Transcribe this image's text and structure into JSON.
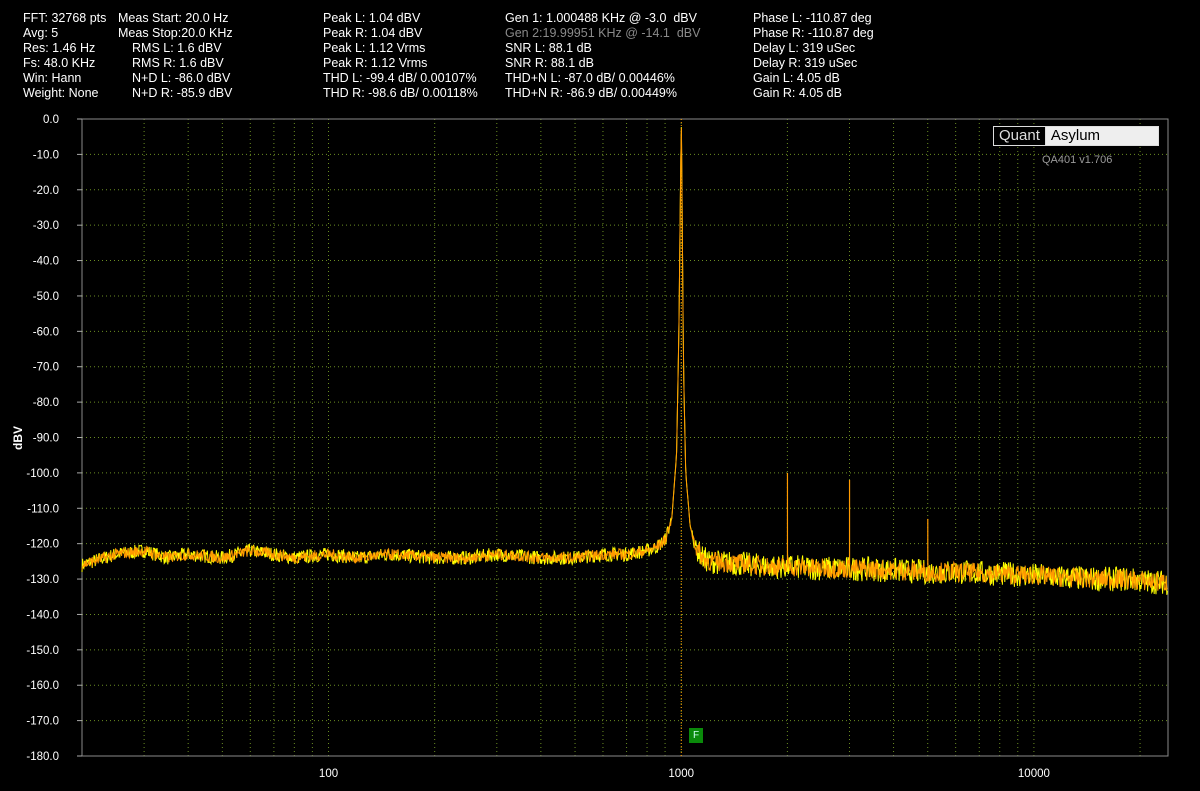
{
  "stats": {
    "col1": [
      "FFT: 32768 pts",
      "Avg: 5",
      "Res: 1.46 Hz",
      "Fs: 48.0 KHz",
      "Win: Hann",
      "Weight: None"
    ],
    "col2": [
      "Meas Start: 20.0 Hz",
      "Meas Stop:20.0 KHz",
      "RMS L: 1.6 dBV",
      "RMS R: 1.6 dBV",
      "N+D L: -86.0 dBV",
      "N+D R: -85.9 dBV"
    ],
    "col3": [
      "Peak L: 1.04 dBV",
      "Peak R: 1.04 dBV",
      "Peak L: 1.12 Vrms",
      "Peak R: 1.12 Vrms",
      "THD L: -99.4 dB/ 0.00107%",
      "THD R: -98.6 dB/ 0.00118%"
    ],
    "col4": [
      "Gen 1: 1.000488 KHz @ -3.0  dBV",
      "Gen 2:19.99951 KHz @ -14.1  dBV",
      "SNR L: 88.1 dB",
      "SNR R: 88.1 dB",
      "THD+N L: -87.0 dB/ 0.00446%",
      "THD+N R: -86.9 dB/ 0.00449%"
    ],
    "col5": [
      "Phase L: -110.87 deg",
      "Phase R: -110.87 deg",
      "Delay L: 319 uSec",
      "Delay R: 319 uSec",
      "Gain L: 4.05 dB",
      "Gain R: 4.05 dB"
    ]
  },
  "branding": {
    "logo_left": "Quant",
    "logo_right": "Asylum",
    "version": "QA401 v1.706"
  },
  "marker_label": "F",
  "colors": {
    "background": "#000000",
    "grid": "#6b8e23",
    "trace_left": "#ff9a00",
    "trace_right": "#ffff00",
    "text": "#ffffff"
  },
  "chart_data": {
    "type": "line",
    "ylabel": "dBV",
    "xlabel": "",
    "xscale": "log",
    "xlim": [
      20,
      24000
    ],
    "ylim": [
      -180,
      0
    ],
    "yticks": [
      0,
      -10,
      -20,
      -30,
      -40,
      -50,
      -60,
      -70,
      -80,
      -90,
      -100,
      -110,
      -120,
      -130,
      -140,
      -150,
      -160,
      -170,
      -180
    ],
    "ytick_labels": [
      "0.0",
      "-10.0",
      "-20.0",
      "-30.0",
      "-40.0",
      "-50.0",
      "-60.0",
      "-70.0",
      "-80.0",
      "-90.0",
      "-100.0",
      "-110.0",
      "-120.0",
      "-130.0",
      "-140.0",
      "-150.0",
      "-160.0",
      "-170.0",
      "-180.0"
    ],
    "xticks": [
      100,
      1000,
      10000
    ],
    "xtick_labels": [
      "100",
      "1000",
      "10000"
    ],
    "grid": true,
    "series": [
      {
        "x": [
          20,
          25,
          30,
          35,
          40,
          50,
          60,
          70,
          80,
          100,
          120,
          150,
          200,
          250,
          300,
          400,
          500,
          600,
          700,
          800,
          850,
          900,
          940,
          970,
          985,
          995,
          1000.5,
          1006,
          1015,
          1030,
          1060,
          1100,
          1150,
          1200,
          1400,
          1600,
          1800,
          2000,
          2500,
          3000,
          4000,
          5000,
          6000,
          8000,
          10000,
          12000,
          15000,
          18000,
          20000,
          24000
        ],
        "y": [
          -126,
          -123,
          -122,
          -124,
          -123,
          -124,
          -122,
          -123,
          -124,
          -123,
          -124,
          -123,
          -124,
          -124,
          -123,
          -124,
          -124,
          -123,
          -123,
          -122,
          -121,
          -119,
          -113,
          -95,
          -60,
          -20,
          1,
          -25,
          -70,
          -100,
          -115,
          -121,
          -124,
          -125,
          -125.5,
          -126,
          -126.5,
          -126.5,
          -127,
          -127,
          -127.5,
          -128,
          -128,
          -128.5,
          -129,
          -129.5,
          -130,
          -130,
          -130.5,
          -131
        ]
      }
    ],
    "harmonics": [
      {
        "x": 2001,
        "y": -100
      },
      {
        "x": 3001,
        "y": -102
      },
      {
        "x": 5002,
        "y": -113
      }
    ]
  }
}
